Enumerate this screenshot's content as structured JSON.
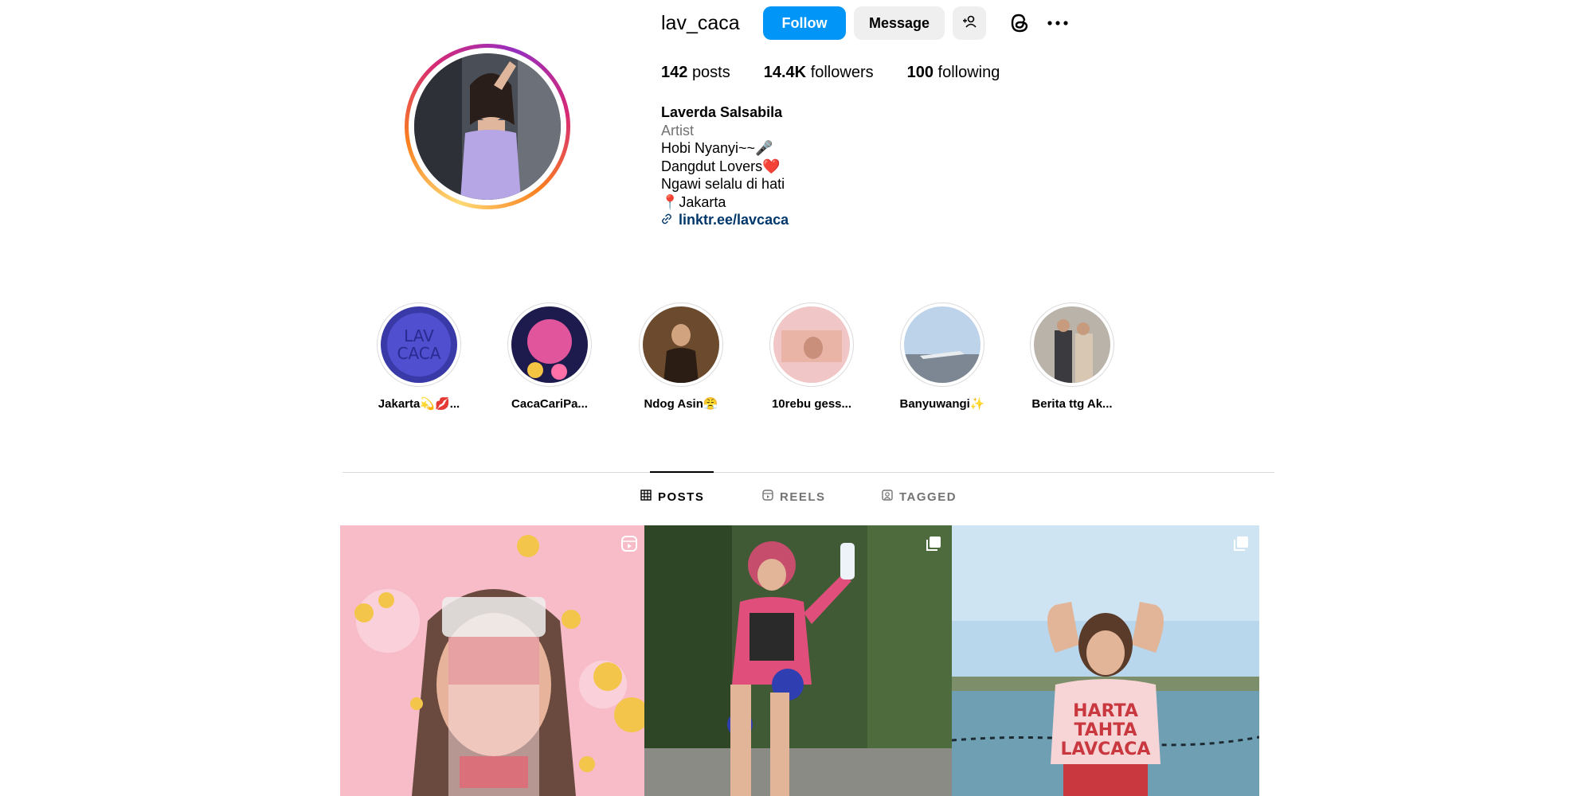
{
  "profile": {
    "username": "lav_caca",
    "follow_label": "Follow",
    "message_label": "Message",
    "stats": {
      "posts_count": "142",
      "posts_label": "posts",
      "followers_count": "14.4K",
      "followers_label": "followers",
      "following_count": "100",
      "following_label": "following"
    },
    "bio": {
      "name": "Laverda Salsabila",
      "category": "Artist",
      "lines": [
        "Hobi Nyanyi~~🎤",
        "Dangdut Lovers❤️",
        "Ngawi selalu di hati",
        "📍Jakarta"
      ],
      "link": "linktr.ee/lavcaca"
    }
  },
  "highlights": [
    {
      "label": "Jakarta💫💋..."
    },
    {
      "label": "CacaCariPa..."
    },
    {
      "label": "Ndog Asin😤"
    },
    {
      "label": "10rebu gess..."
    },
    {
      "label": "Banyuwangi✨"
    },
    {
      "label": "Berita ttg Ak..."
    }
  ],
  "tabs": [
    {
      "label": "POSTS",
      "active": true
    },
    {
      "label": "REELS",
      "active": false
    },
    {
      "label": "TAGGED",
      "active": false
    }
  ],
  "posts": [
    {
      "type": "reel"
    },
    {
      "type": "carousel"
    },
    {
      "type": "carousel"
    }
  ],
  "colors": {
    "follow_button": "#0095f6",
    "link": "#00376b",
    "secondary_text": "#737373"
  }
}
